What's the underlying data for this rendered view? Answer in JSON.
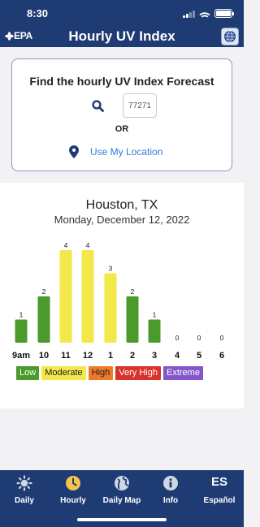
{
  "status_bar": {
    "time": "8:30"
  },
  "header": {
    "logo_text": "EPA",
    "title": "Hourly UV Index"
  },
  "search": {
    "title": "Find the hourly UV Index Forecast",
    "zip_value": "77271",
    "or_label": "OR",
    "location_link": "Use My Location"
  },
  "location": {
    "city": "Houston, TX",
    "date": "Monday, December 12, 2022"
  },
  "chart_data": {
    "type": "bar",
    "categories": [
      "9am",
      "10",
      "11",
      "12",
      "1",
      "2",
      "3",
      "4",
      "5",
      "6"
    ],
    "values": [
      1,
      2,
      4,
      4,
      3,
      2,
      1,
      0,
      0,
      0
    ],
    "bar_colors": [
      "#4a9a2c",
      "#4a9a2c",
      "#f3e84a",
      "#f3e84a",
      "#f3e84a",
      "#4a9a2c",
      "#4a9a2c",
      "#4a9a2c",
      "#4a9a2c",
      "#4a9a2c"
    ],
    "ylim": [
      0,
      4
    ]
  },
  "legend": [
    {
      "label": "Low",
      "color": "#4a9a2c",
      "text_color": "#ffffff"
    },
    {
      "label": "Moderate",
      "color": "#f3e84a",
      "text_color": "#222222"
    },
    {
      "label": "High",
      "color": "#ef7a2a",
      "text_color": "#222222"
    },
    {
      "label": "Very High",
      "color": "#d9322a",
      "text_color": "#ffffff"
    },
    {
      "label": "Extreme",
      "color": "#8456c9",
      "text_color": "#ffffff"
    }
  ],
  "tabs": [
    {
      "label": "Daily",
      "icon": "sun-icon"
    },
    {
      "label": "Hourly",
      "icon": "clock-icon",
      "active": true
    },
    {
      "label": "Daily Map",
      "icon": "globe-icon"
    },
    {
      "label": "Info",
      "icon": "info-icon"
    },
    {
      "label": "Español",
      "icon": "es-icon",
      "glyph": "ES"
    }
  ],
  "colors": {
    "brand_blue": "#1f3b73",
    "link_blue": "#2f7bd8",
    "active_tab": "#f3c54a"
  }
}
